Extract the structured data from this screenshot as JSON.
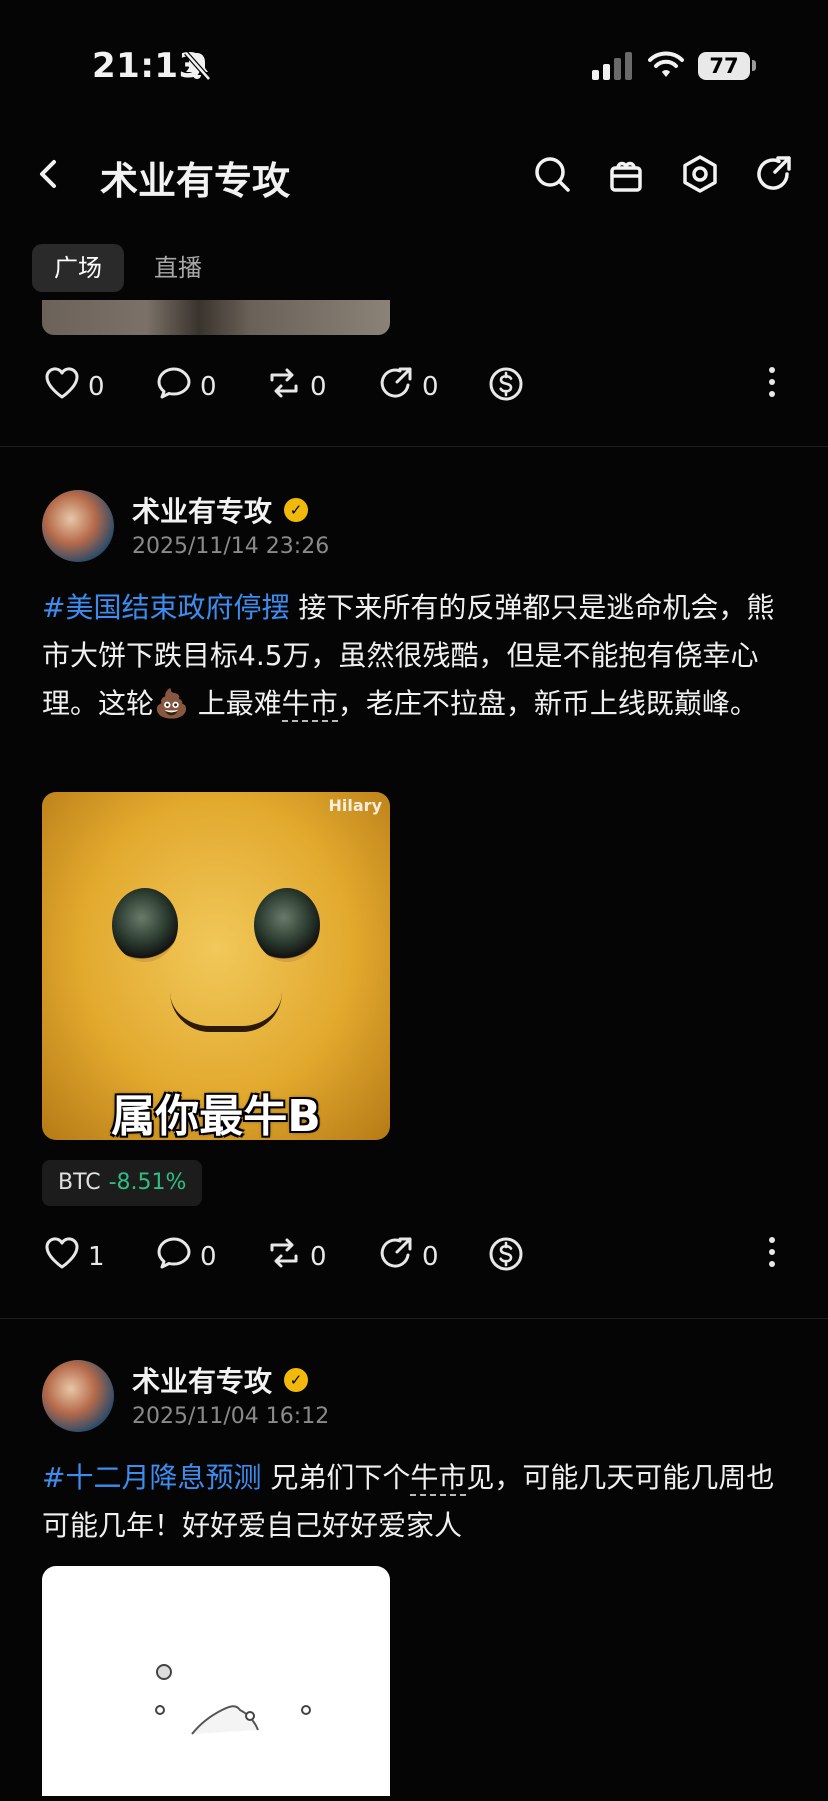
{
  "status_bar": {
    "time": "21:13",
    "battery": "77"
  },
  "header": {
    "title": "术业有专攻"
  },
  "tabs": [
    {
      "label": "广场",
      "active": true
    },
    {
      "label": "直播",
      "active": false
    }
  ],
  "top_post_actions": {
    "likes": "0",
    "comments": "0",
    "reposts": "0",
    "shares": "0"
  },
  "posts": [
    {
      "author": "术业有专攻",
      "date": "2025/11/14 23:26",
      "hashtag": "#美国结束政府停摆",
      "text_1": " 接下来所有的反弹都只是逃命机会，熊市大饼下跌目标4.5万，虽然很残酷，但是不能抱有侥幸心理。这轮",
      "emoji": "💩",
      "text_2": " 上最难",
      "underlined": "牛市",
      "text_3": "，老庄不拉盘，新币上线既巅峰。",
      "image_caption": "属你最牛B",
      "image_watermark": "Hilary",
      "ticker": {
        "symbol": "BTC",
        "change": "-8.51%"
      },
      "actions": {
        "likes": "1",
        "comments": "0",
        "reposts": "0",
        "shares": "0"
      }
    },
    {
      "author": "术业有专攻",
      "date": "2025/11/04 16:12",
      "hashtag": "#十二月降息预测",
      "text_1": " 兄弟们下个",
      "underlined": "牛市",
      "text_2": "见，可能几天可能几周也可能几年！好好爱自己好好爱家人"
    }
  ],
  "colors": {
    "hashtag": "#3b8df0",
    "positive": "#2ebd85",
    "verified": "#f0b90b"
  }
}
